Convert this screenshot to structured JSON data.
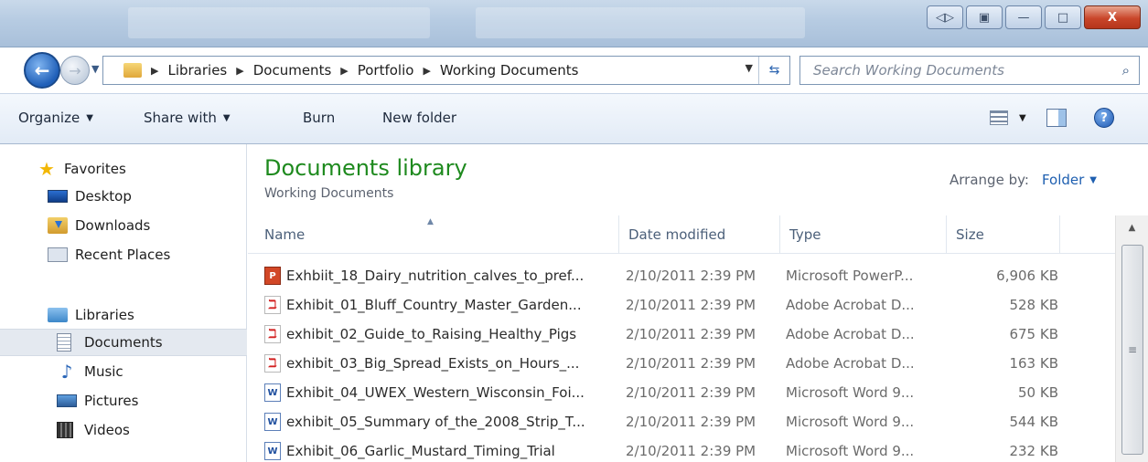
{
  "window": {
    "minimize_icon": "minimize-icon",
    "maximize_icon": "maximize-icon",
    "close_label": "X"
  },
  "address": {
    "crumbs": [
      "Libraries",
      "Documents",
      "Portfolio",
      "Working Documents"
    ]
  },
  "search": {
    "placeholder": "Search Working Documents"
  },
  "toolbar": {
    "organize": "Organize",
    "share_with": "Share with",
    "burn": "Burn",
    "new_folder": "New folder",
    "help_label": "?"
  },
  "nav": {
    "favorites": "Favorites",
    "desktop": "Desktop",
    "downloads": "Downloads",
    "recent_places": "Recent Places",
    "libraries": "Libraries",
    "documents": "Documents",
    "music": "Music",
    "pictures": "Pictures",
    "videos": "Videos"
  },
  "content": {
    "title": "Documents library",
    "subtitle": "Working Documents",
    "arrange_label": "Arrange by:",
    "arrange_value": "Folder"
  },
  "columns": {
    "name": "Name",
    "date": "Date modified",
    "type": "Type",
    "size": "Size"
  },
  "files": [
    {
      "name": "Exhbiit_18_Dairy_nutrition_calves_to_pref...",
      "date": "2/10/2011 2:39 PM",
      "type": "Microsoft PowerP...",
      "size": "6,906 KB",
      "icon": "ppt"
    },
    {
      "name": "Exhibit_01_Bluff_Country_Master_Garden...",
      "date": "2/10/2011 2:39 PM",
      "type": "Adobe Acrobat D...",
      "size": "528 KB",
      "icon": "pdf"
    },
    {
      "name": "exhibit_02_Guide_to_Raising_Healthy_Pigs",
      "date": "2/10/2011 2:39 PM",
      "type": "Adobe Acrobat D...",
      "size": "675 KB",
      "icon": "pdf"
    },
    {
      "name": "exhibit_03_Big_Spread_Exists_on_Hours_...",
      "date": "2/10/2011 2:39 PM",
      "type": "Adobe Acrobat D...",
      "size": "163 KB",
      "icon": "pdf"
    },
    {
      "name": "Exhibit_04_UWEX_Western_Wisconsin_Foi...",
      "date": "2/10/2011 2:39 PM",
      "type": "Microsoft Word 9...",
      "size": "50 KB",
      "icon": "doc"
    },
    {
      "name": "exhibit_05_Summary of_the_2008_Strip_T...",
      "date": "2/10/2011 2:39 PM",
      "type": "Microsoft Word 9...",
      "size": "544 KB",
      "icon": "doc"
    },
    {
      "name": "Exhibit_06_Garlic_Mustard_Timing_Trial",
      "date": "2/10/2011 2:39 PM",
      "type": "Microsoft Word 9...",
      "size": "232 KB",
      "icon": "doc"
    }
  ]
}
